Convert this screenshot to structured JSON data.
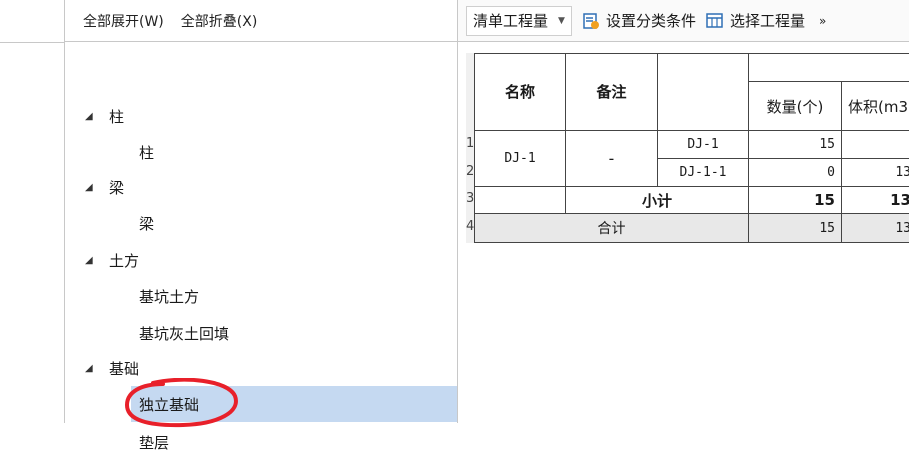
{
  "tree_toolbar": {
    "expand_all": "全部展开(W)",
    "collapse_all": "全部折叠(X)"
  },
  "tree": {
    "groups": [
      {
        "label": "柱",
        "children": [
          "柱"
        ]
      },
      {
        "label": "梁",
        "children": [
          "梁"
        ]
      },
      {
        "label": "土方",
        "children": [
          "基坑土方",
          "基坑灰土回填"
        ]
      },
      {
        "label": "基础",
        "children": [
          "独立基础",
          "垫层"
        ]
      }
    ],
    "selected": "独立基础",
    "annotation_color": "#e8202a"
  },
  "right_toolbar": {
    "dropdown_value": "清单工程量",
    "set_category": "设置分类条件",
    "select_quantity": "选择工程量",
    "more": "»"
  },
  "table": {
    "headers": {
      "name": "名称",
      "remark": "备注",
      "qty": "数量(个)",
      "volume": "体积(m3"
    },
    "row_numbers": [
      "1",
      "2",
      "3",
      "4"
    ],
    "rows": [
      {
        "name": "DJ-1",
        "remark": "-",
        "sub": "DJ-1",
        "qty": "15",
        "volume": ""
      },
      {
        "sub": "DJ-1-1",
        "qty": "0",
        "volume": "13"
      }
    ],
    "subtotal": {
      "label": "小计",
      "qty": "15",
      "volume": "13"
    },
    "total": {
      "label": "合计",
      "qty": "15",
      "volume": "13"
    }
  }
}
